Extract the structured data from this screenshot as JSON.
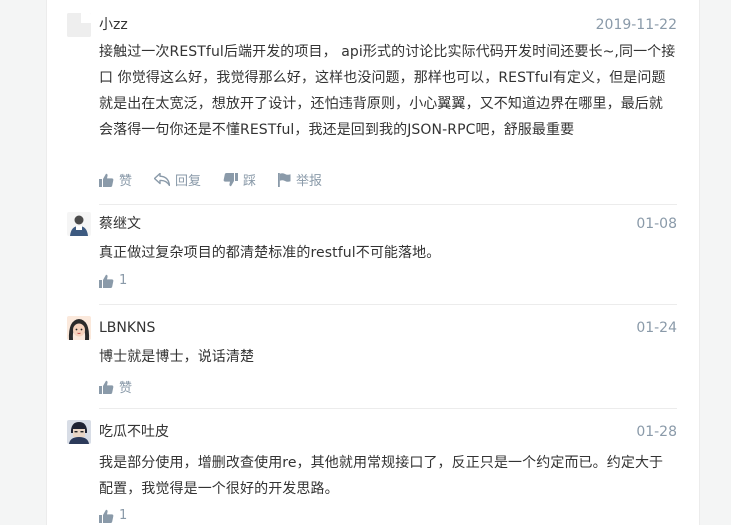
{
  "comments": [
    {
      "name": "小zz",
      "date": "2019-11-22",
      "text": "接触过一次RESTful后端开发的项目， api形式的讨论比实际代码开发时间还要长~,同一个接口 你觉得这么好，我觉得那么好，这样也没问题，那样也可以，RESTful有定义，但是问题就是出在太宽泛，想放开了设计，还怕违背原则，小心翼翼，又不知道边界在哪里，最后就会落得一句你还是不懂RESTful，我还是回到我的JSON-RPC吧，舒服最重要",
      "actions": {
        "like": "赞",
        "reply": "回复",
        "dislike": "踩",
        "report": "举报"
      },
      "avatar_icon": "blank-avatar-icon"
    },
    {
      "name": "蔡继文",
      "date": "01-08",
      "text": "真正做过复杂项目的都清楚标准的restful不可能落地。",
      "like_count": "1",
      "avatar_icon": "person-avatar-icon"
    },
    {
      "name": "LBNKNS",
      "date": "01-24",
      "text": "博士就是博士，说话清楚",
      "like_label": "赞",
      "avatar_icon": "girl-avatar-icon"
    },
    {
      "name": "吃瓜不吐皮",
      "date": "01-28",
      "text": "我是部分使用，增删改查使用re，其他就用常规接口了，反正只是一个约定而已。约定大于配置，我觉得是一个很好的开发思路。",
      "like_count": "1",
      "avatar_icon": "character-avatar-icon"
    }
  ],
  "colors": {
    "text": "#333333",
    "muted": "#8a9aa9",
    "divider": "#ececec",
    "background": "#f4f5f5"
  }
}
